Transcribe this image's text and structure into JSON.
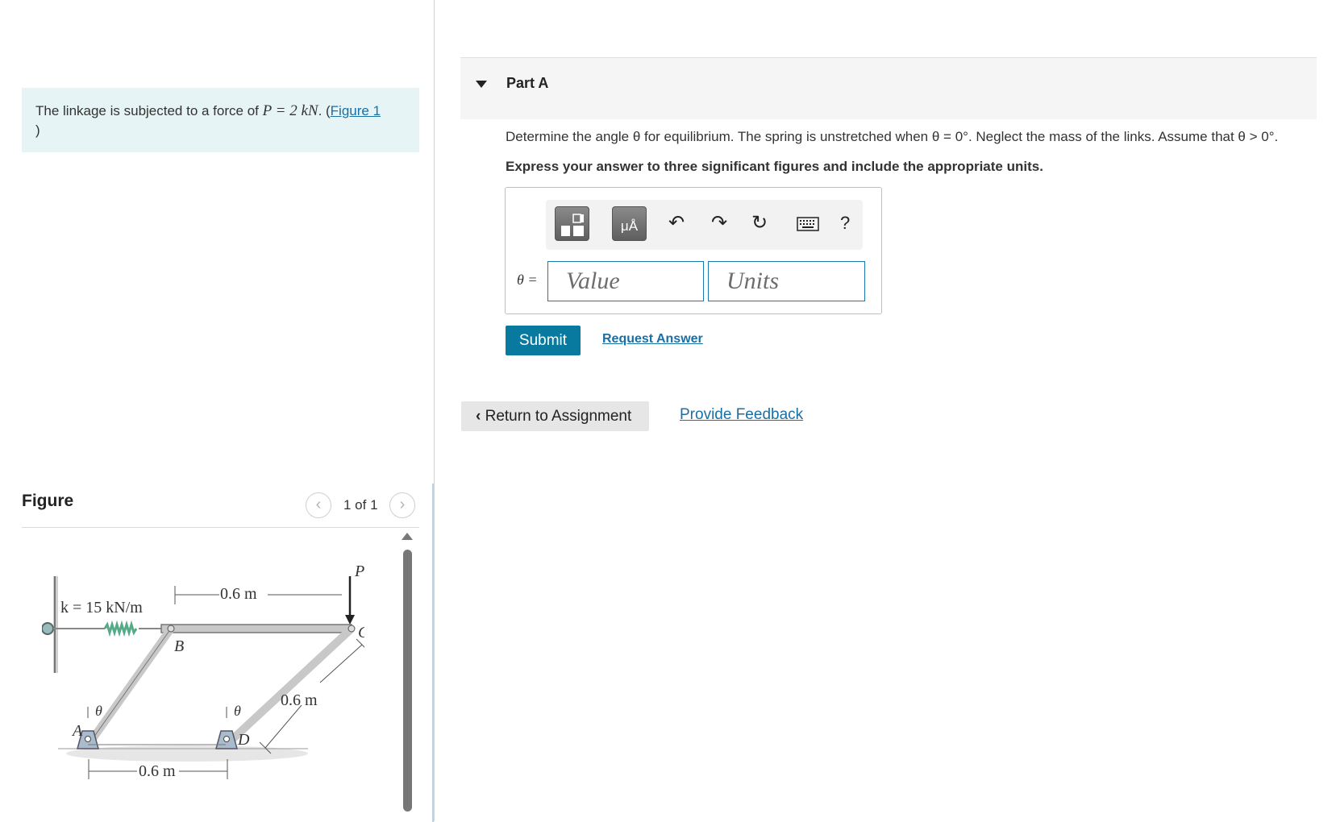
{
  "problem": {
    "text_before": "The linkage is subjected to a force of ",
    "math": "P = 2 kN",
    "text_after": ". (",
    "figure_link": "Figure 1",
    "closing": ")"
  },
  "figure": {
    "heading": "Figure",
    "counter": "1 of 1",
    "prev_icon": "chevron-left-icon",
    "next_icon": "chevron-right-icon",
    "labels": {
      "spring": "k = 15 kN/m",
      "top_length": "0.6 m",
      "force": "P",
      "point_a": "A",
      "point_b": "B",
      "point_c": "C",
      "point_d": "D",
      "theta": "θ",
      "link_length": "0.6 m",
      "bottom_length": "0.6 m"
    }
  },
  "part": {
    "title": "Part A",
    "question": "Determine the angle θ for equilibrium. The spring is unstretched when θ = 0°. Neglect the mass of the links. Assume that θ > 0°.",
    "instruction": "Express your answer to three significant figures and include the appropriate units."
  },
  "answer": {
    "variable_label": "θ =",
    "value_placeholder": "Value",
    "units_placeholder": "Units",
    "toolbar": {
      "templates_icon": "templates-icon",
      "units_label": "μÅ",
      "undo_icon": "undo-icon",
      "redo_icon": "redo-icon",
      "reset_icon": "reset-icon",
      "keyboard_icon": "keyboard-icon",
      "help_label": "?"
    }
  },
  "actions": {
    "submit": "Submit",
    "request_answer": "Request Answer",
    "return": "Return to Assignment",
    "feedback": "Provide Feedback"
  },
  "colors": {
    "accent": "#087aa0",
    "link": "#1a6fa3",
    "problem_bg": "#e6f4f6"
  }
}
